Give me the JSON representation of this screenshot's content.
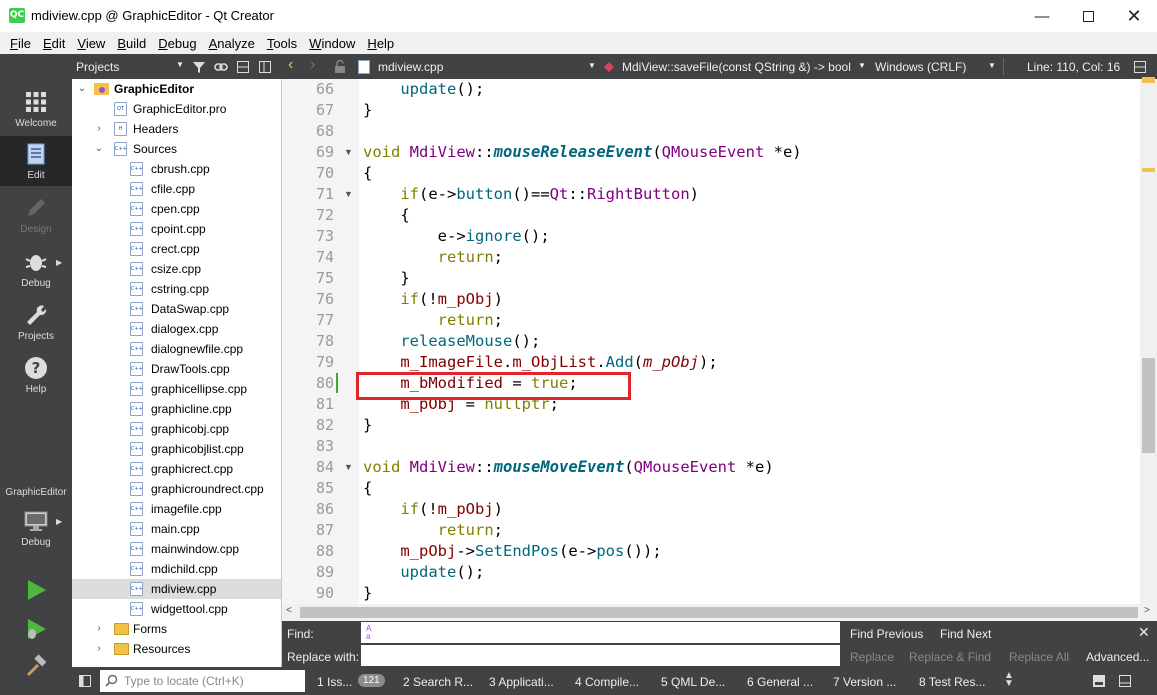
{
  "window": {
    "title": "mdiview.cpp @ GraphicEditor - Qt Creator",
    "logo": "QC"
  },
  "menu": [
    "File",
    "Edit",
    "View",
    "Build",
    "Debug",
    "Analyze",
    "Tools",
    "Window",
    "Help"
  ],
  "modes": [
    {
      "label": "Welcome",
      "icon": "grid-icon"
    },
    {
      "label": "Edit",
      "icon": "edit-document-icon"
    },
    {
      "label": "Design",
      "icon": "pencil-icon"
    },
    {
      "label": "Debug",
      "icon": "bug-icon"
    },
    {
      "label": "Projects",
      "icon": "wrench-icon"
    },
    {
      "label": "Help",
      "icon": "help-icon"
    }
  ],
  "kit": {
    "project": "GraphicEditor",
    "label": "Debug"
  },
  "projects_panel": {
    "title": "Projects"
  },
  "tree": {
    "root": "GraphicEditor",
    "pro": "GraphicEditor.pro",
    "headers": "Headers",
    "sources": "Sources",
    "files": [
      "cbrush.cpp",
      "cfile.cpp",
      "cpen.cpp",
      "cpoint.cpp",
      "crect.cpp",
      "csize.cpp",
      "cstring.cpp",
      "DataSwap.cpp",
      "dialogex.cpp",
      "dialognewfile.cpp",
      "DrawTools.cpp",
      "graphicellipse.cpp",
      "graphicline.cpp",
      "graphicobj.cpp",
      "graphicobjlist.cpp",
      "graphicrect.cpp",
      "graphicroundrect.cpp",
      "imagefile.cpp",
      "main.cpp",
      "mainwindow.cpp",
      "mdichild.cpp",
      "mdiview.cpp",
      "widgettool.cpp"
    ],
    "selected": "mdiview.cpp",
    "forms": "Forms",
    "resources": "Resources"
  },
  "editor": {
    "file": "mdiview.cpp",
    "symbol": "MdiView::saveFile(const QString &) -> bool",
    "encoding": "Windows (CRLF)",
    "position": "Line: 110, Col: 16",
    "line_numbers": [
      "66",
      "67",
      "68",
      "69",
      "70",
      "71",
      "72",
      "73",
      "74",
      "75",
      "76",
      "77",
      "78",
      "79",
      "80",
      "81",
      "82",
      "83",
      "84",
      "85",
      "86",
      "87",
      "88",
      "89",
      "90"
    ]
  },
  "find": {
    "find_label": "Find:",
    "replace_label": "Replace with:",
    "find_previous": "Find Previous",
    "find_next": "Find Next",
    "replace": "Replace",
    "replace_find": "Replace & Find",
    "replace_all": "Replace All",
    "advanced": "Advanced...",
    "case_glyph": "Aa"
  },
  "status": {
    "locate_placeholder": "Type to locate (Ctrl+K)",
    "tabs": [
      "1 Iss...",
      "2 Search R...",
      "3 Applicati...",
      "4 Compile...",
      "5 QML De...",
      "6 General ...",
      "7 Version ...",
      "8 Test Res..."
    ],
    "issues_badge": "121"
  },
  "colors": {
    "dark_panel": "#404244",
    "highlight_box": "#e0262a",
    "keyword": "#808000",
    "type": "#800080",
    "function": "#00677c",
    "member": "#800000"
  }
}
